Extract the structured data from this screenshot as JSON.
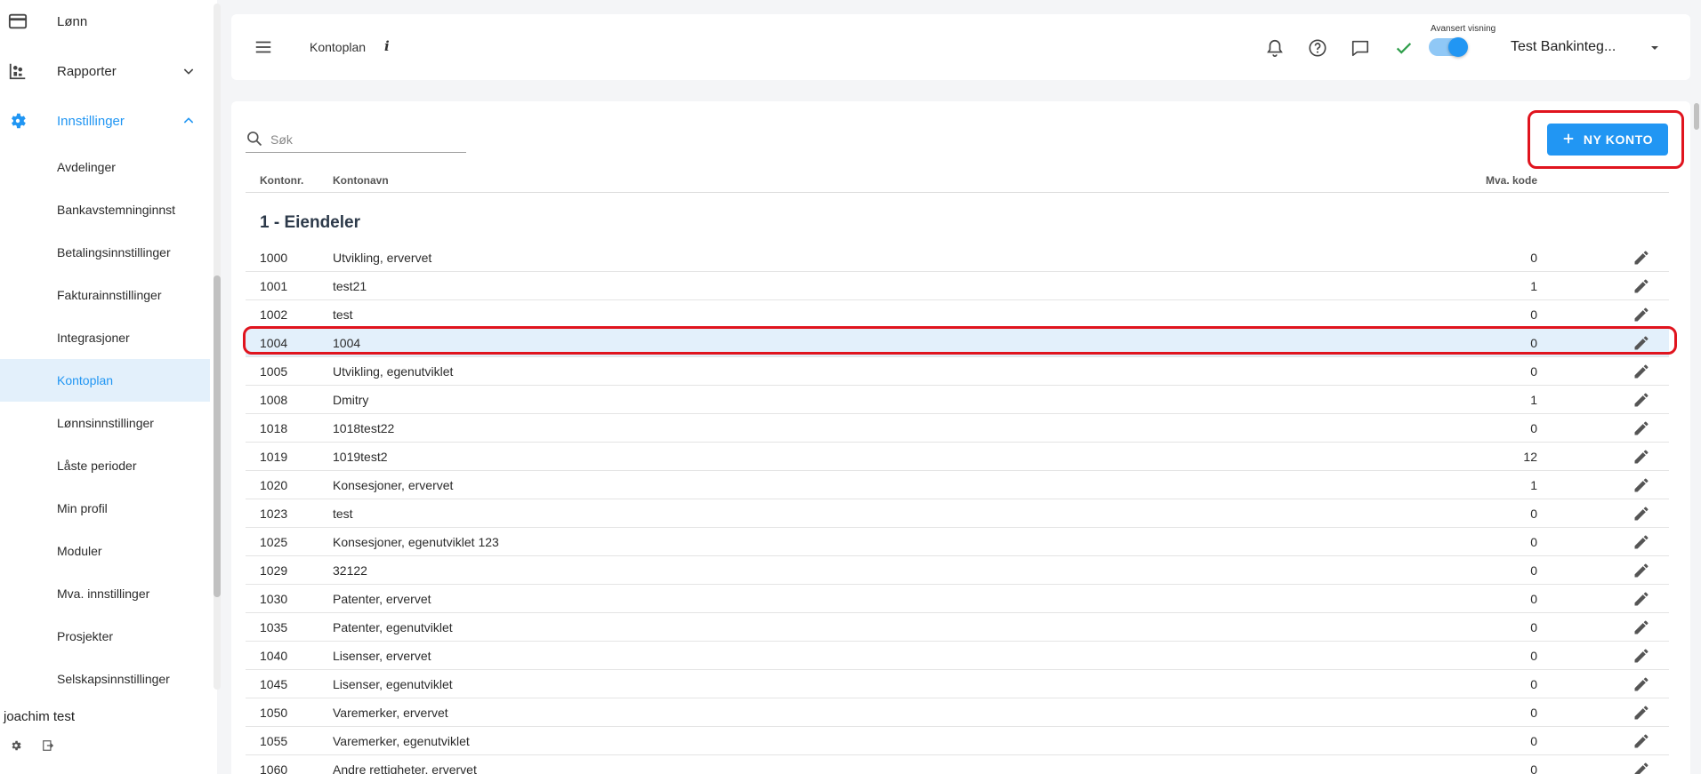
{
  "sidebar": {
    "items": [
      {
        "label": "Lønn",
        "icon": "credit-card-icon"
      },
      {
        "label": "Rapporter",
        "icon": "reports-icon"
      },
      {
        "label": "Innstillinger",
        "icon": "gear-icon"
      }
    ],
    "settings_items": [
      {
        "label": "Avdelinger"
      },
      {
        "label": "Bankavstemninginnst"
      },
      {
        "label": "Betalingsinnstillinger"
      },
      {
        "label": "Fakturainnstillinger"
      },
      {
        "label": "Integrasjoner"
      },
      {
        "label": "Kontoplan"
      },
      {
        "label": "Lønnsinnstillinger"
      },
      {
        "label": "Låste perioder"
      },
      {
        "label": "Min profil"
      },
      {
        "label": "Moduler"
      },
      {
        "label": "Mva. innstillinger"
      },
      {
        "label": "Prosjekter"
      },
      {
        "label": "Selskapsinnstillinger"
      }
    ],
    "selected": "Kontoplan",
    "user": {
      "name": "joachim test"
    }
  },
  "header": {
    "title": "Kontoplan",
    "info": "i",
    "advanced_view_label": "Avansert visning",
    "advanced_view_on": true,
    "company": "Test Bankinteg..."
  },
  "colors": {
    "accent": "#2196f3",
    "highlight": "#e3f0fb",
    "annotation": "#e0141e",
    "success": "#2e9e4a"
  },
  "toolbar": {
    "search_placeholder": "Søk",
    "new_account_label": "NY KONTO"
  },
  "table": {
    "columns": {
      "number": "Kontonr.",
      "name": "Kontonavn",
      "vat": "Mva. kode"
    },
    "group_title": "1 - Eiendeler",
    "rows": [
      {
        "number": "1000",
        "name": "Utvikling, ervervet",
        "vat": "0"
      },
      {
        "number": "1001",
        "name": "test21",
        "vat": "1"
      },
      {
        "number": "1002",
        "name": "test",
        "vat": "0"
      },
      {
        "number": "1004",
        "name": "1004",
        "vat": "0"
      },
      {
        "number": "1005",
        "name": "Utvikling, egenutviklet",
        "vat": "0"
      },
      {
        "number": "1008",
        "name": "Dmitry",
        "vat": "1"
      },
      {
        "number": "1018",
        "name": "1018test22",
        "vat": "0"
      },
      {
        "number": "1019",
        "name": "1019test2",
        "vat": "12"
      },
      {
        "number": "1020",
        "name": "Konsesjoner, ervervet",
        "vat": "1"
      },
      {
        "number": "1023",
        "name": "test",
        "vat": "0"
      },
      {
        "number": "1025",
        "name": "Konsesjoner, egenutviklet 123",
        "vat": "0"
      },
      {
        "number": "1029",
        "name": "32122",
        "vat": "0"
      },
      {
        "number": "1030",
        "name": "Patenter, ervervet",
        "vat": "0"
      },
      {
        "number": "1035",
        "name": "Patenter, egenutviklet",
        "vat": "0"
      },
      {
        "number": "1040",
        "name": "Lisenser, ervervet",
        "vat": "0"
      },
      {
        "number": "1045",
        "name": "Lisenser, egenutviklet",
        "vat": "0"
      },
      {
        "number": "1050",
        "name": "Varemerker, ervervet",
        "vat": "0"
      },
      {
        "number": "1055",
        "name": "Varemerker, egenutviklet",
        "vat": "0"
      },
      {
        "number": "1060",
        "name": "Andre rettigheter, ervervet",
        "vat": "0"
      }
    ],
    "highlighted_row": "1004"
  }
}
